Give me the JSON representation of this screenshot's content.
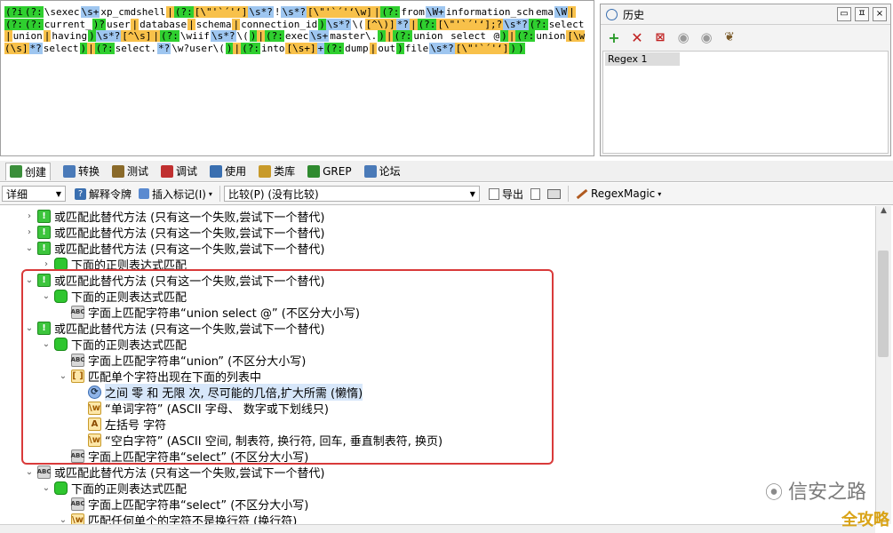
{
  "regex": {
    "tokens": [
      [
        "(?i",
        "g"
      ],
      [
        "(?:",
        "g"
      ],
      [
        "\\sexec",
        "w"
      ],
      [
        "\\s+",
        "b"
      ],
      [
        "xp_cmdshell",
        "w"
      ],
      [
        "|",
        "y"
      ],
      [
        "(?:",
        "g"
      ],
      [
        "[\\\"'`´'‘]",
        "y"
      ],
      [
        "\\s*?",
        "b"
      ],
      [
        "!",
        "w"
      ],
      [
        "\\s*?",
        "b"
      ],
      [
        "[\\\"'`´'‘\\w]",
        "y"
      ],
      [
        "|",
        "y"
      ],
      [
        "(?:",
        "g"
      ],
      [
        "from",
        "w"
      ],
      [
        "\\W+",
        "b"
      ],
      [
        "information_sch",
        "w"
      ],
      [
        "ema",
        "w"
      ],
      [
        "\\W",
        "b"
      ],
      [
        "|",
        "y"
      ],
      [
        "(?:",
        "g"
      ],
      [
        "(?:",
        "g"
      ],
      [
        "current_",
        "w"
      ],
      [
        ")?",
        "g"
      ],
      [
        "user",
        "w"
      ],
      [
        "|",
        "y"
      ],
      [
        "database",
        "w"
      ],
      [
        "|",
        "y"
      ],
      [
        "schema",
        "w"
      ],
      [
        "|",
        "y"
      ],
      [
        "connection_id",
        "w"
      ],
      [
        ")",
        "g"
      ],
      [
        "\\s*?",
        "b"
      ],
      [
        "\\(",
        "w"
      ],
      [
        "[^\\)]",
        "y"
      ],
      [
        "*?",
        "b"
      ],
      [
        "|",
        "y"
      ],
      [
        "(?:",
        "g"
      ],
      [
        "[\\\"'`´'‘];?",
        "y"
      ],
      [
        "\\s*?",
        "b"
      ],
      [
        "(?:",
        "g"
      ],
      [
        "select",
        "w"
      ],
      [
        "|",
        "y"
      ],
      [
        "union",
        "w"
      ],
      [
        "|",
        "y"
      ],
      [
        "having",
        "w"
      ],
      [
        ")",
        "g"
      ],
      [
        "\\s*?",
        "b"
      ],
      [
        "[^\\s]",
        "y"
      ],
      [
        "|",
        "y"
      ],
      [
        "(?:",
        "g"
      ],
      [
        "\\wiif",
        "w"
      ],
      [
        "\\s*?",
        "b"
      ],
      [
        "\\(",
        "w"
      ],
      [
        ")",
        "g"
      ],
      [
        "|",
        "y"
      ],
      [
        "(?:",
        "g"
      ],
      [
        "exec",
        "w"
      ],
      [
        "\\s+",
        "b"
      ],
      [
        "master\\.",
        "w"
      ],
      [
        ")",
        "g"
      ],
      [
        "|",
        "y"
      ],
      [
        "(?:",
        "g"
      ],
      [
        "union",
        "w"
      ],
      [
        " select ",
        "w"
      ],
      [
        "@",
        "w"
      ],
      [
        ")",
        "g"
      ],
      [
        "|",
        "y"
      ],
      [
        "(?:",
        "g"
      ],
      [
        "union",
        "w"
      ],
      [
        "[\\w(\\s]",
        "y"
      ],
      [
        "*?",
        "b"
      ],
      [
        "select",
        "w"
      ],
      [
        ")",
        "g"
      ],
      [
        "|",
        "y"
      ],
      [
        "(?:",
        "g"
      ],
      [
        "select.",
        "w"
      ],
      [
        "*?",
        "b"
      ],
      [
        "\\w?user\\(",
        "w"
      ],
      [
        ")",
        "g"
      ],
      [
        "|",
        "y"
      ],
      [
        "(?:",
        "g"
      ],
      [
        "into",
        "w"
      ],
      [
        "[\\s+]",
        "y"
      ],
      [
        "+",
        "b"
      ],
      [
        "(?:",
        "g"
      ],
      [
        "dump",
        "w"
      ],
      [
        "|",
        "y"
      ],
      [
        "out",
        "w"
      ],
      [
        ")",
        "g"
      ],
      [
        "file",
        "w"
      ],
      [
        "\\s*?",
        "b"
      ],
      [
        "[\\\"'`´'‘]",
        "y"
      ],
      [
        ")",
        "g"
      ],
      [
        ")",
        "g"
      ]
    ]
  },
  "history": {
    "title": "历史",
    "pin": "ㅍ",
    "close": "×",
    "items": [
      "Regex 1"
    ]
  },
  "tabs": [
    {
      "label": "创建",
      "icon": "create-icon",
      "color": "#3b8f3b",
      "active": true
    },
    {
      "label": "转换",
      "icon": "convert-icon",
      "color": "#4a7ab8",
      "active": false
    },
    {
      "label": "测试",
      "icon": "test-icon",
      "color": "#8a6a2a",
      "active": false
    },
    {
      "label": "调试",
      "icon": "debug-icon",
      "color": "#c03030",
      "active": false
    },
    {
      "label": "使用",
      "icon": "use-icon",
      "color": "#3a6fb0",
      "active": false
    },
    {
      "label": "类库",
      "icon": "library-icon",
      "color": "#c89a2a",
      "active": false
    },
    {
      "label": "GREP",
      "icon": "grep-icon",
      "color": "#2f8a2f",
      "active": false
    },
    {
      "label": "论坛",
      "icon": "forum-icon",
      "color": "#4a7ab8",
      "active": false
    }
  ],
  "toolbar": {
    "mode": "详细",
    "explain": "解释令牌",
    "insert": "插入标记(I)",
    "compare": "比较(P) (没有比较)",
    "export": "导出",
    "regexmagic": "RegexMagic"
  },
  "tree": [
    {
      "indent": 0,
      "chev": "›",
      "icon": "alt",
      "text": "或匹配此替代方法 (只有这一个失败,尝试下一个替代)"
    },
    {
      "indent": 0,
      "chev": "›",
      "icon": "alt",
      "text": "或匹配此替代方法 (只有这一个失败,尝试下一个替代)"
    },
    {
      "indent": 0,
      "chev": "⌄",
      "icon": "alt",
      "text": "或匹配此替代方法 (只有这一个失败,尝试下一个替代)"
    },
    {
      "indent": 1,
      "chev": "›",
      "icon": "grp",
      "text": "下面的正则表达式匹配"
    },
    {
      "indent": 0,
      "chev": "⌄",
      "icon": "alt",
      "text": "或匹配此替代方法 (只有这一个失败,尝试下一个替代)"
    },
    {
      "indent": 1,
      "chev": "⌄",
      "icon": "grp",
      "text": "下面的正则表达式匹配"
    },
    {
      "indent": 2,
      "chev": "",
      "icon": "lit",
      "text": "字面上匹配字符串“union select @” (不区分大小写)"
    },
    {
      "indent": 0,
      "chev": "⌄",
      "icon": "alt",
      "text": "或匹配此替代方法 (只有这一个失败,尝试下一个替代)"
    },
    {
      "indent": 1,
      "chev": "⌄",
      "icon": "grp",
      "text": "下面的正则表达式匹配"
    },
    {
      "indent": 2,
      "chev": "",
      "icon": "lit",
      "text": "字面上匹配字符串“union” (不区分大小写)"
    },
    {
      "indent": 2,
      "chev": "⌄",
      "icon": "cls",
      "text": "匹配单个字符出现在下面的列表中"
    },
    {
      "indent": 3,
      "chev": "",
      "icon": "quant",
      "text": "之间 零 和 无限 次, 尽可能的几倍,扩大所需 (懒惰)",
      "selected": true
    },
    {
      "indent": 3,
      "chev": "",
      "icon": "word",
      "text": "“单词字符” (ASCII 字母、 数字或下划线只)"
    },
    {
      "indent": 3,
      "chev": "",
      "icon": "char",
      "text": "左括号 字符"
    },
    {
      "indent": 3,
      "chev": "",
      "icon": "word",
      "text": "“空白字符” (ASCII 空间, 制表符, 换行符, 回车, 垂直制表符, 换页)"
    },
    {
      "indent": 2,
      "chev": "",
      "icon": "lit",
      "text": "字面上匹配字符串“select” (不区分大小写)"
    },
    {
      "indent": 0,
      "chev": "⌄",
      "icon": "lit",
      "text": "或匹配此替代方法 (只有这一个失败,尝试下一个替代)"
    },
    {
      "indent": 1,
      "chev": "⌄",
      "icon": "grp",
      "text": "下面的正则表达式匹配"
    },
    {
      "indent": 2,
      "chev": "",
      "icon": "lit",
      "text": "字面上匹配字符串“select” (不区分大小写)"
    },
    {
      "indent": 2,
      "chev": "⌄",
      "icon": "word",
      "text": "匹配任何单个的字符不是换行符 (换行符)"
    }
  ],
  "watermark": {
    "text": "信安之路",
    "corner": "全攻略"
  }
}
